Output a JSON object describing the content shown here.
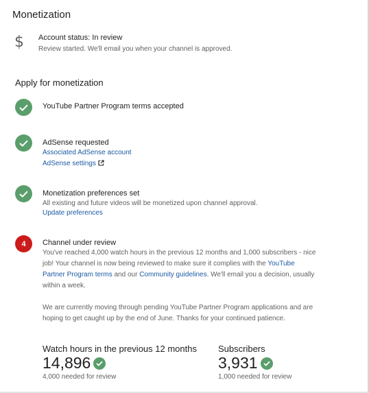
{
  "header": {
    "title": "Monetization"
  },
  "account": {
    "icon": "dollar-icon",
    "status": "Account status: In review",
    "description": "Review started. We'll email you when your channel is approved."
  },
  "apply": {
    "title": "Apply for monetization",
    "steps": [
      {
        "state": "done",
        "title": "YouTube Partner Program terms accepted"
      },
      {
        "state": "done",
        "title": "AdSense requested",
        "links": [
          "Associated AdSense account",
          "AdSense settings"
        ]
      },
      {
        "state": "done",
        "title": "Monetization preferences set",
        "description": "All existing and future videos will be monetized upon channel approval.",
        "links": [
          "Update preferences"
        ]
      },
      {
        "state": "current",
        "number": "4",
        "title": "Channel under review",
        "p1_a": "You've reached 4,000 watch hours in the previous 12 months and 1,000 subscribers - nice job! Your channel is now being reviewed to make sure it complies with the ",
        "p1_link1": "YouTube Partner Program terms",
        "p1_b": " and our ",
        "p1_link2": "Community guidelines",
        "p1_c": ". We'll email you a decision, usually within a week.",
        "p2": "We are currently moving through pending YouTube Partner Program applications and are hoping to get caught up by the end of June. Thanks for your continued patience."
      }
    ]
  },
  "stats": {
    "watch_hours": {
      "label": "Watch hours in the previous 12 months",
      "value": "14,896",
      "requirement": "4,000 needed for review"
    },
    "subscribers": {
      "label": "Subscribers",
      "value": "3,931",
      "requirement": "1,000 needed for review"
    }
  },
  "colors": {
    "success": "#5a9e6b",
    "alert": "#cc1b1b",
    "link": "#1a5aa3"
  }
}
